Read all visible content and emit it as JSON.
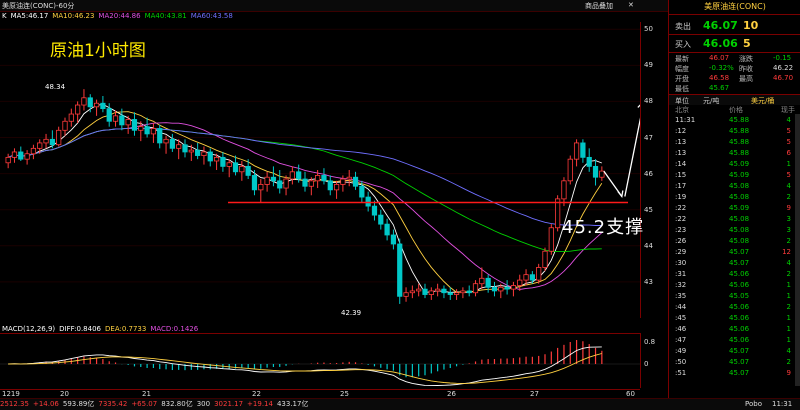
{
  "window": {
    "title": "美原油连(CONC)-60分",
    "menu_label": "商品叠加",
    "close_label": "✕"
  },
  "ma_legend": [
    {
      "label": "K",
      "color": "#ffffff"
    },
    {
      "label": "MA5:46.17",
      "color": "#ffffff"
    },
    {
      "label": "MA10:46.23",
      "color": "#ffd040"
    },
    {
      "label": "MA20:44.86",
      "color": "#e050e0"
    },
    {
      "label": "MA40:43.81",
      "color": "#00d000"
    },
    {
      "label": "MA60:43.58",
      "color": "#6f6fff"
    }
  ],
  "annotations": {
    "title": "原油1小时图",
    "support": "45.2支撑",
    "high_label": "48.34",
    "low_label": "42.39"
  },
  "price_axis": [
    {
      "label": "50",
      "price": 50
    },
    {
      "label": "49",
      "price": 49
    },
    {
      "label": "48",
      "price": 48
    },
    {
      "label": "47",
      "price": 47
    },
    {
      "label": "46",
      "price": 46
    },
    {
      "label": "45",
      "price": 45
    },
    {
      "label": "44",
      "price": 44
    },
    {
      "label": "43",
      "price": 43
    }
  ],
  "macd_axis": [
    {
      "label": "0.8"
    },
    {
      "label": "0"
    }
  ],
  "date_axis": [
    "1219",
    "20",
    "21",
    "22",
    "25",
    "26",
    "27",
    "60分"
  ],
  "macd_legend": [
    {
      "label": "MACD(12,26,9)",
      "color": "#ffffff"
    },
    {
      "label": "DIFF:0.8406",
      "color": "#ffffff"
    },
    {
      "label": "DEA:0.7733",
      "color": "#ffd040"
    },
    {
      "label": "MACD:0.1426",
      "color": "#e050e0"
    }
  ],
  "bottom_bar": [
    {
      "label": "2512.35",
      "color": "#ff3b3b"
    },
    {
      "label": "+14.06",
      "color": "#ff3b3b"
    },
    {
      "label": "593.89亿",
      "color": "#dddddd"
    },
    {
      "label": "7335.42",
      "color": "#ff3b3b"
    },
    {
      "label": "+65.07",
      "color": "#ff3b3b"
    },
    {
      "label": "832.80亿",
      "color": "#dddddd"
    },
    {
      "label": "300",
      "color": "#dddddd"
    },
    {
      "label": "3021.17",
      "color": "#ff3b3b"
    },
    {
      "label": "+19.14",
      "color": "#ff3b3b"
    },
    {
      "label": "433.17亿",
      "color": "#dddddd"
    }
  ],
  "bottom_right": {
    "brand": "Pobo",
    "time": "11:31"
  },
  "quote": {
    "title": "美原油连(CONC)",
    "sell_label": "卖出",
    "sell_price": "46.07",
    "sell_qty": "10",
    "buy_label": "买入",
    "buy_price": "46.06",
    "buy_qty": "5",
    "rows": [
      {
        "l1": "最新",
        "v1": "46.07",
        "c1": "#ff3b3b",
        "l2": "涨跌",
        "v2": "-0.15",
        "c2": "#00d000"
      },
      {
        "l1": "幅度",
        "v1": "-0.32%",
        "c1": "#00d000",
        "l2": "昨收",
        "v2": "46.22",
        "c2": "#dddddd"
      },
      {
        "l1": "开盘",
        "v1": "46.58",
        "c1": "#ff3b3b",
        "l2": "最高",
        "v2": "46.70",
        "c2": "#ff3b3b"
      },
      {
        "l1": "最低",
        "v1": "45.67",
        "c1": "#00d000",
        "l2": "",
        "v2": "",
        "c2": "#dddddd"
      }
    ],
    "unit_label": "单位",
    "unit_value": "元/吨",
    "currency_label": "美元/桶",
    "trade_headers": [
      "北京",
      "价格",
      "现手"
    ],
    "time_first": "11:31"
  },
  "trades": [
    {
      "t": "11:31",
      "p": "45.88",
      "q": "4"
    },
    {
      "t": ":12",
      "p": "45.88",
      "q": "5"
    },
    {
      "t": ":13",
      "p": "45.88",
      "q": "5"
    },
    {
      "t": ":13",
      "p": "45.88",
      "q": "6"
    },
    {
      "t": ":14",
      "p": "45.09",
      "q": "1"
    },
    {
      "t": ":15",
      "p": "45.09",
      "q": "5"
    },
    {
      "t": ":17",
      "p": "45.08",
      "q": "4"
    },
    {
      "t": ":19",
      "p": "45.08",
      "q": "2"
    },
    {
      "t": ":22",
      "p": "45.09",
      "q": "9"
    },
    {
      "t": ":22",
      "p": "45.08",
      "q": "3"
    },
    {
      "t": ":23",
      "p": "45.08",
      "q": "3"
    },
    {
      "t": ":26",
      "p": "45.08",
      "q": "2"
    },
    {
      "t": ":29",
      "p": "45.07",
      "q": "12"
    },
    {
      "t": ":30",
      "p": "45.07",
      "q": "4"
    },
    {
      "t": ":31",
      "p": "45.06",
      "q": "2"
    },
    {
      "t": ":32",
      "p": "45.06",
      "q": "1"
    },
    {
      "t": ":35",
      "p": "45.05",
      "q": "1"
    },
    {
      "t": ":44",
      "p": "45.06",
      "q": "2"
    },
    {
      "t": ":45",
      "p": "45.06",
      "q": "1"
    },
    {
      "t": ":46",
      "p": "45.06",
      "q": "1"
    },
    {
      "t": ":47",
      "p": "45.06",
      "q": "1"
    },
    {
      "t": ":49",
      "p": "45.07",
      "q": "4"
    },
    {
      "t": ":50",
      "p": "45.07",
      "q": "2"
    },
    {
      "t": ":51",
      "p": "45.07",
      "q": "9"
    }
  ],
  "chart_data": {
    "type": "candlestick",
    "title": "",
    "ylim": [
      42.0,
      50.2
    ],
    "support_level": 45.2,
    "candles": [
      [
        46.3,
        46.55,
        46.15,
        46.45
      ],
      [
        46.45,
        46.7,
        46.3,
        46.6
      ],
      [
        46.6,
        46.75,
        46.35,
        46.4
      ],
      [
        46.4,
        46.65,
        46.25,
        46.55
      ],
      [
        46.55,
        46.8,
        46.4,
        46.7
      ],
      [
        46.7,
        46.95,
        46.55,
        46.85
      ],
      [
        46.85,
        47.1,
        46.7,
        46.95
      ],
      [
        46.95,
        47.2,
        46.7,
        46.8
      ],
      [
        46.8,
        47.3,
        46.75,
        47.2
      ],
      [
        47.2,
        47.55,
        47.05,
        47.45
      ],
      [
        47.45,
        47.8,
        47.3,
        47.65
      ],
      [
        47.65,
        48.0,
        47.4,
        47.9
      ],
      [
        47.9,
        48.34,
        47.75,
        48.1
      ],
      [
        48.1,
        48.2,
        47.7,
        47.85
      ],
      [
        47.85,
        48.05,
        47.6,
        47.95
      ],
      [
        47.95,
        48.15,
        47.7,
        47.8
      ],
      [
        47.8,
        47.95,
        47.3,
        47.45
      ],
      [
        47.45,
        47.75,
        47.3,
        47.6
      ],
      [
        47.6,
        47.8,
        47.2,
        47.35
      ],
      [
        47.35,
        47.6,
        47.1,
        47.5
      ],
      [
        47.5,
        47.7,
        47.05,
        47.2
      ],
      [
        47.2,
        47.45,
        46.9,
        47.3
      ],
      [
        47.3,
        47.55,
        47.0,
        47.1
      ],
      [
        47.1,
        47.4,
        46.85,
        47.25
      ],
      [
        47.25,
        47.35,
        46.7,
        46.85
      ],
      [
        46.85,
        47.05,
        46.55,
        46.95
      ],
      [
        46.95,
        47.1,
        46.6,
        46.7
      ],
      [
        46.7,
        46.95,
        46.4,
        46.8
      ],
      [
        46.8,
        46.95,
        46.45,
        46.6
      ],
      [
        46.6,
        46.8,
        46.35,
        46.65
      ],
      [
        46.65,
        46.85,
        46.4,
        46.5
      ],
      [
        46.5,
        46.75,
        46.25,
        46.6
      ],
      [
        46.6,
        46.7,
        46.2,
        46.35
      ],
      [
        46.35,
        46.55,
        46.1,
        46.45
      ],
      [
        46.45,
        46.6,
        46.05,
        46.2
      ],
      [
        46.2,
        46.4,
        45.9,
        46.3
      ],
      [
        46.3,
        46.5,
        45.95,
        46.05
      ],
      [
        46.05,
        46.35,
        45.8,
        46.2
      ],
      [
        46.2,
        46.4,
        45.85,
        45.95
      ],
      [
        45.95,
        46.1,
        45.4,
        45.55
      ],
      [
        45.55,
        45.85,
        45.2,
        45.7
      ],
      [
        45.7,
        46.05,
        45.5,
        45.9
      ],
      [
        45.9,
        46.2,
        45.65,
        45.8
      ],
      [
        45.8,
        46.1,
        45.45,
        45.6
      ],
      [
        45.6,
        45.95,
        45.4,
        45.85
      ],
      [
        45.85,
        46.2,
        45.7,
        46.05
      ],
      [
        46.05,
        46.25,
        45.75,
        45.85
      ],
      [
        45.85,
        46.05,
        45.5,
        45.65
      ],
      [
        45.65,
        45.9,
        45.4,
        45.8
      ],
      [
        45.8,
        46.1,
        45.6,
        45.95
      ],
      [
        45.95,
        46.15,
        45.7,
        45.8
      ],
      [
        45.8,
        45.95,
        45.4,
        45.55
      ],
      [
        45.55,
        45.8,
        45.3,
        45.7
      ],
      [
        45.7,
        45.95,
        45.5,
        45.85
      ],
      [
        45.85,
        46.1,
        45.65,
        45.9
      ],
      [
        45.9,
        46.05,
        45.55,
        45.65
      ],
      [
        45.65,
        45.8,
        45.2,
        45.35
      ],
      [
        45.35,
        45.5,
        44.95,
        45.1
      ],
      [
        45.1,
        45.25,
        44.7,
        44.85
      ],
      [
        44.85,
        45.0,
        44.45,
        44.6
      ],
      [
        44.6,
        44.75,
        44.15,
        44.3
      ],
      [
        44.3,
        44.45,
        43.9,
        44.05
      ],
      [
        44.05,
        44.2,
        42.39,
        42.6
      ],
      [
        42.6,
        42.85,
        42.45,
        42.7
      ],
      [
        42.7,
        42.9,
        42.55,
        42.75
      ],
      [
        42.75,
        42.95,
        42.6,
        42.8
      ],
      [
        42.8,
        42.95,
        42.55,
        42.65
      ],
      [
        42.65,
        42.85,
        42.5,
        42.75
      ],
      [
        42.75,
        42.95,
        42.6,
        42.8
      ],
      [
        42.8,
        42.9,
        42.55,
        42.7
      ],
      [
        42.7,
        42.85,
        42.5,
        42.65
      ],
      [
        42.65,
        42.8,
        42.5,
        42.7
      ],
      [
        42.7,
        42.85,
        42.55,
        42.75
      ],
      [
        42.75,
        42.9,
        42.6,
        42.7
      ],
      [
        42.7,
        43.05,
        42.6,
        42.95
      ],
      [
        42.95,
        43.4,
        42.8,
        43.1
      ],
      [
        43.1,
        43.2,
        42.7,
        42.85
      ],
      [
        42.85,
        43.0,
        42.6,
        42.75
      ],
      [
        42.75,
        42.95,
        42.55,
        42.85
      ],
      [
        42.85,
        43.05,
        42.65,
        42.8
      ],
      [
        42.8,
        43.0,
        42.6,
        42.9
      ],
      [
        42.9,
        43.2,
        42.75,
        43.05
      ],
      [
        43.05,
        43.35,
        42.9,
        43.2
      ],
      [
        43.2,
        43.3,
        42.95,
        43.05
      ],
      [
        43.05,
        43.5,
        42.95,
        43.4
      ],
      [
        43.4,
        43.95,
        43.3,
        43.85
      ],
      [
        43.85,
        44.6,
        43.75,
        44.5
      ],
      [
        44.5,
        45.4,
        44.4,
        45.3
      ],
      [
        45.3,
        45.9,
        45.1,
        45.8
      ],
      [
        45.8,
        46.5,
        45.7,
        46.4
      ],
      [
        46.4,
        46.95,
        46.2,
        46.85
      ],
      [
        46.85,
        46.95,
        46.3,
        46.45
      ],
      [
        46.45,
        46.7,
        46.05,
        46.2
      ],
      [
        46.2,
        46.4,
        45.67,
        45.9
      ],
      [
        45.9,
        46.2,
        45.8,
        46.07
      ]
    ]
  }
}
